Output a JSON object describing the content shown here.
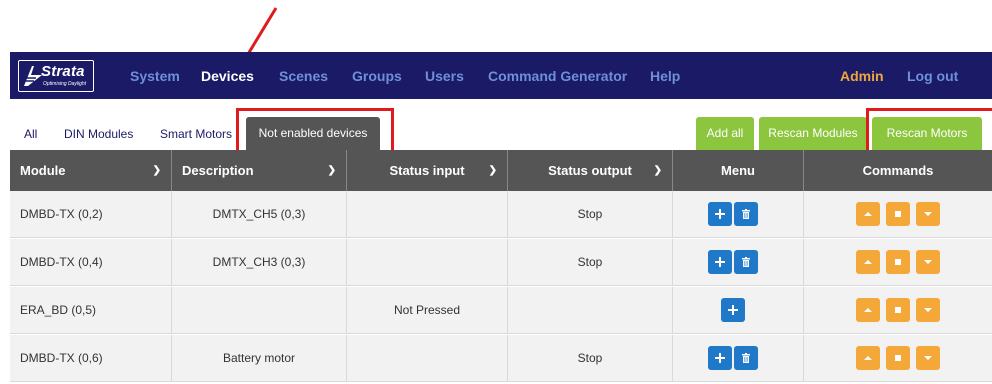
{
  "brand": {
    "name": "Strata",
    "tagline": "Optimising Daylight"
  },
  "nav": {
    "items": [
      {
        "label": "System"
      },
      {
        "label": "Devices"
      },
      {
        "label": "Scenes"
      },
      {
        "label": "Groups"
      },
      {
        "label": "Users"
      },
      {
        "label": "Command Generator"
      },
      {
        "label": "Help"
      }
    ],
    "admin_label": "Admin",
    "logout_label": "Log out"
  },
  "subtabs": {
    "items": [
      {
        "label": "All"
      },
      {
        "label": "DIN Modules"
      },
      {
        "label": "Smart Motors"
      }
    ],
    "active_label": "Not enabled devices"
  },
  "actions": {
    "add_all": "Add all",
    "rescan_modules": "Rescan Modules",
    "rescan_motors": "Rescan Motors"
  },
  "table": {
    "columns": [
      "Module",
      "Description",
      "Status input",
      "Status output",
      "Menu",
      "Commands"
    ],
    "rows": [
      {
        "module": "DMBD-TX (0,2)",
        "description": "DMTX_CH5 (0,3)",
        "status_input": "",
        "status_output": "Stop"
      },
      {
        "module": "DMBD-TX (0,4)",
        "description": "DMTX_CH3 (0,3)",
        "status_input": "",
        "status_output": "Stop"
      },
      {
        "module": "ERA_BD (0,5)",
        "description": "",
        "status_input": "Not Pressed",
        "status_output": ""
      },
      {
        "module": "DMBD-TX (0,6)",
        "description": "Battery motor",
        "status_input": "",
        "status_output": "Stop"
      }
    ]
  },
  "icons": {
    "add": "plus-icon",
    "delete": "trash-icon",
    "up": "triangle-up-icon",
    "stop": "square-stop-icon",
    "down": "triangle-down-icon"
  },
  "colors": {
    "navbar": "#1a1a66",
    "nav_inactive": "#6f8fd8",
    "admin": "#f0a63c",
    "header": "#555555",
    "green": "#8cc63f",
    "blue": "#1f78c8",
    "orange": "#f5a83a",
    "annotation_red": "#e01b1b"
  }
}
